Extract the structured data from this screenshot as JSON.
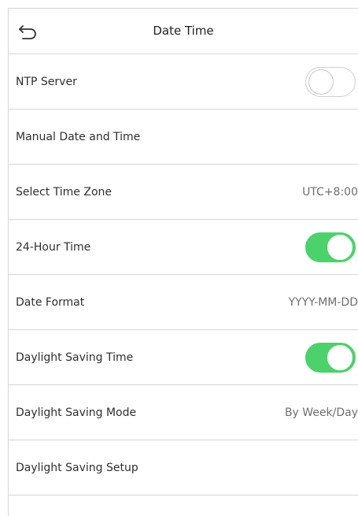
{
  "header": {
    "title": "Date Time",
    "back_icon": "back-arrow-icon"
  },
  "colors": {
    "toggle_on": "#4cd26a",
    "divider": "#d6d6d6"
  },
  "rows": [
    {
      "label": "NTP Server",
      "toggle": false
    },
    {
      "label": "Manual Date and Time"
    },
    {
      "label": "Select Time Zone",
      "value": "UTC+8:00"
    },
    {
      "label": "24-Hour Time",
      "toggle": true
    },
    {
      "label": "Date Format",
      "value": "YYYY-MM-DD"
    },
    {
      "label": "Daylight Saving Time",
      "toggle": true
    },
    {
      "label": "Daylight Saving Mode",
      "value": "By Week/Day"
    },
    {
      "label": "Daylight Saving Setup"
    }
  ]
}
